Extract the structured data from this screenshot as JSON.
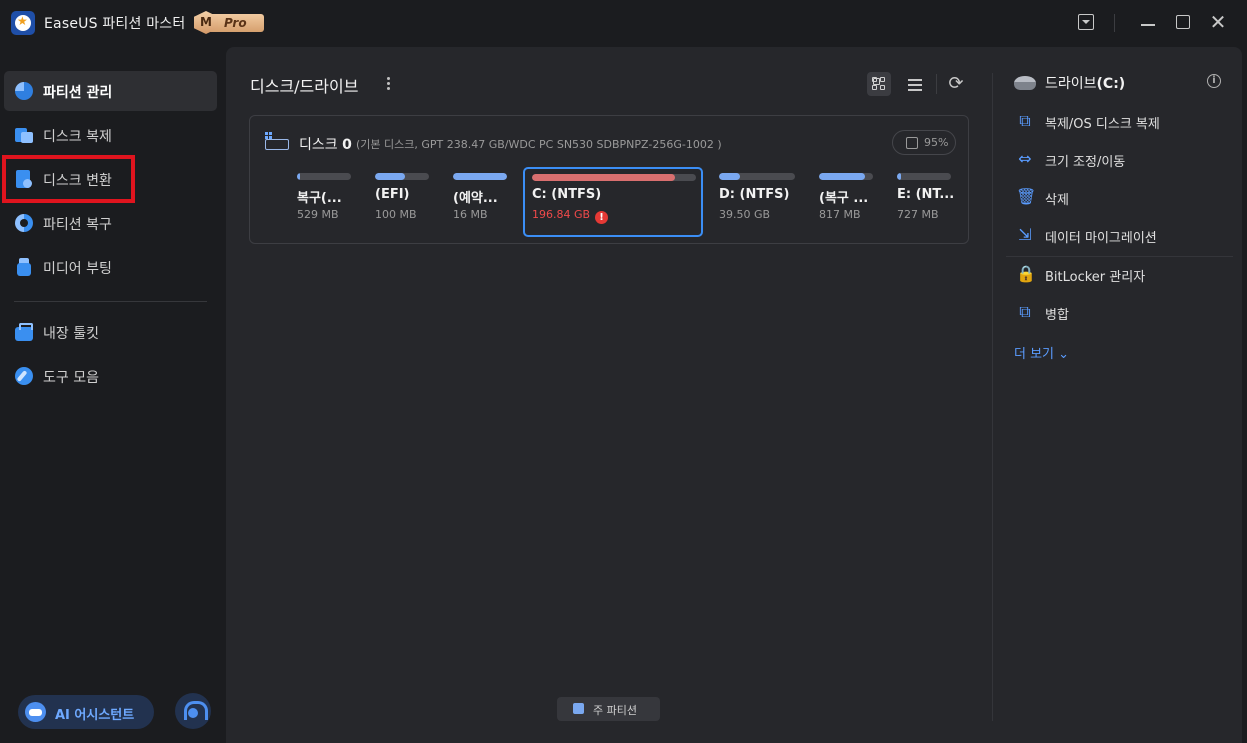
{
  "app": {
    "title": "EaseUS 파티션 마스터",
    "badge_letter": "M",
    "badge_label": "Pro"
  },
  "window_controls": {
    "close": "✕"
  },
  "sidebar": {
    "items": [
      {
        "label": "파티션 관리",
        "icon": "pie-chart-icon",
        "active": true
      },
      {
        "label": "디스크 복제",
        "icon": "clone-icon",
        "active": false
      },
      {
        "label": "디스크 변환",
        "icon": "disk-convert-icon",
        "active": false,
        "highlighted": true
      },
      {
        "label": "파티션 복구",
        "icon": "partition-recovery-icon",
        "active": false
      },
      {
        "label": "미디어 부팅",
        "icon": "usb-media-icon",
        "active": false
      },
      {
        "label": "내장 툴킷",
        "icon": "toolkit-icon",
        "active": false
      },
      {
        "label": "도구 모음",
        "icon": "tools-icon",
        "active": false
      }
    ],
    "ai_assistant_label": "AI 어시스턴트"
  },
  "main": {
    "title": "디스크/드라이브",
    "refresh_glyph": "⟳",
    "disk": {
      "name_prefix": "디스크 ",
      "name_number": "0",
      "info": "(기본 디스크, GPT 238.47 GB/WDC PC SN530 SDBPNPZ-256G-1002 )",
      "health": "95%",
      "partitions": [
        {
          "name": "복구(...",
          "size": "529 MB",
          "used_fraction": 0.05
        },
        {
          "name": "(EFI)",
          "size": "100 MB",
          "used_fraction": 0.55
        },
        {
          "name": "(예약...",
          "size": "16 MB",
          "used_fraction": 1.0
        },
        {
          "name": "C: (NTFS)",
          "size": "196.84 GB",
          "used_fraction": 0.87,
          "selected": true,
          "warning": true
        },
        {
          "name": "D: (NTFS)",
          "size": "39.50 GB",
          "used_fraction": 0.28
        },
        {
          "name": "(복구 ...",
          "size": "817 MB",
          "used_fraction": 0.85
        },
        {
          "name": "E: (NT...",
          "size": "727 MB",
          "used_fraction": 0.07
        }
      ]
    },
    "legend": {
      "label": "주 파티션",
      "color": "#7aa8f0"
    }
  },
  "right_panel": {
    "drive_prefix": "드라이브",
    "drive_letter": "(C:)",
    "info_glyph": "i",
    "actions": [
      {
        "label": "복제/OS 디스크 복제",
        "icon": "clone-grid-icon",
        "glyph": "⧉"
      },
      {
        "label": "크기 조정/이동",
        "icon": "resize-arrows-icon",
        "glyph": "⇔"
      },
      {
        "label": "삭제",
        "icon": "trash-icon",
        "glyph": "🗑"
      },
      {
        "label": "데이터 마이그레이션",
        "icon": "migration-icon",
        "glyph": "⇲"
      },
      {
        "label": "BitLocker 관리자",
        "icon": "bitlocker-icon",
        "glyph": "🔒"
      },
      {
        "label": "병합",
        "icon": "merge-icon",
        "glyph": "⧉"
      }
    ],
    "more_label": "더 보기",
    "more_glyph": "⌄"
  },
  "colors": {
    "accent": "#3b8ef5",
    "warning": "#ef4a4a",
    "highlight_box": "#e0141e",
    "used_bar": "#7aa8f0",
    "selected_bar": "#d96f6f"
  }
}
